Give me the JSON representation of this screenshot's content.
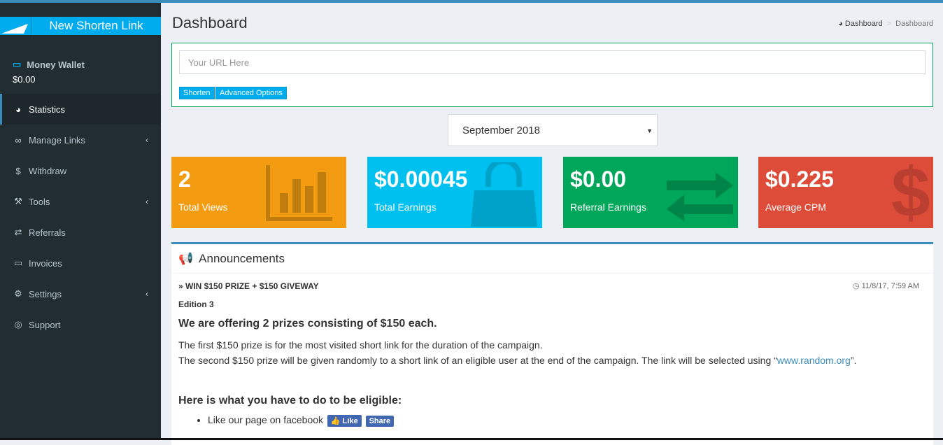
{
  "sidebar": {
    "new_link": "New Shorten Link",
    "wallet_label": "Money Wallet",
    "wallet_value": "$0.00",
    "items": [
      {
        "label": "Statistics",
        "icon": "dashboard-icon"
      },
      {
        "label": "Manage Links",
        "icon": "link-icon"
      },
      {
        "label": "Withdraw",
        "icon": "dollar-icon"
      },
      {
        "label": "Tools",
        "icon": "wrench-icon"
      },
      {
        "label": "Referrals",
        "icon": "exchange-icon"
      },
      {
        "label": "Invoices",
        "icon": "credit-card-icon"
      },
      {
        "label": "Settings",
        "icon": "gears-icon"
      },
      {
        "label": "Support",
        "icon": "life-ring-icon"
      }
    ]
  },
  "header": {
    "title": "Dashboard",
    "breadcrumb": [
      "Dashboard",
      "Dashboard"
    ],
    "breadcrumb_sep": ">"
  },
  "shorten": {
    "placeholder": "Your URL Here",
    "shorten": "Shorten",
    "advanced": "Advanced Options"
  },
  "month": {
    "selected": "September 2018"
  },
  "stats": [
    {
      "value": "2",
      "label": "Total Views",
      "color": "#f39c12"
    },
    {
      "value": "$0.00045",
      "label": "Total Earnings",
      "color": "#00c0ef"
    },
    {
      "value": "$0.00",
      "label": "Referral Earnings",
      "color": "#00a65a"
    },
    {
      "value": "$0.225",
      "label": "Average CPM",
      "color": "#dd4b39"
    }
  ],
  "announcements": {
    "title": "Announcements",
    "post_title": "WIN $150 PRIZE + $150 GIVEWAY",
    "date": "11/8/17, 7:59 AM",
    "edition": "Edition 3",
    "heading": "We are offering 2 prizes consisting of $150 each.",
    "p1": "The first $150 prize is for the most visited short link for the duration of the campaign.",
    "p2a": "The second $150 prize will be given randomly to a short link of an eligible user at the end of the campaign. The link will be selected using “",
    "p2link": "www.random.org",
    "p2b": "”.",
    "heading2": "Here is what you have to do to be eligible:",
    "li1": "Like our page on facebook",
    "like": "Like",
    "share": "Share"
  }
}
